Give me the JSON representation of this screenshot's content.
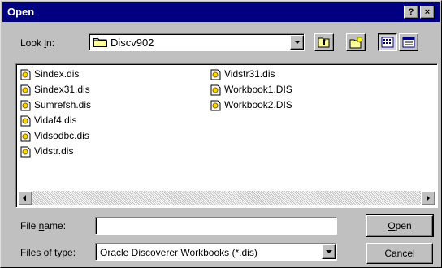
{
  "window": {
    "title": "Open",
    "help_label": "?",
    "close_label": "×"
  },
  "lookin": {
    "label_pre": "Look ",
    "label_key": "i",
    "label_post": "n:",
    "value": "Discv902"
  },
  "files": {
    "col1": [
      "Sindex.dis",
      "Sindex31.dis",
      "Sumrefsh.dis",
      "Vidaf4.dis",
      "Vidsodbc.dis",
      "Vidstr.dis"
    ],
    "col2": [
      "Vidstr31.dis",
      "Workbook1.DIS",
      "Workbook2.DIS"
    ]
  },
  "filename": {
    "label_pre": "File ",
    "label_key": "n",
    "label_post": "ame:",
    "value": ""
  },
  "filetype": {
    "label_pre": "Files of ",
    "label_key": "t",
    "label_post": "ype:",
    "value": "Oracle Discoverer Workbooks (*.dis)"
  },
  "buttons": {
    "open_key": "O",
    "open_rest": "pen",
    "cancel_label": "Cancel"
  },
  "colors": {
    "title_bar": "#000080",
    "face": "#c0c0c0"
  }
}
